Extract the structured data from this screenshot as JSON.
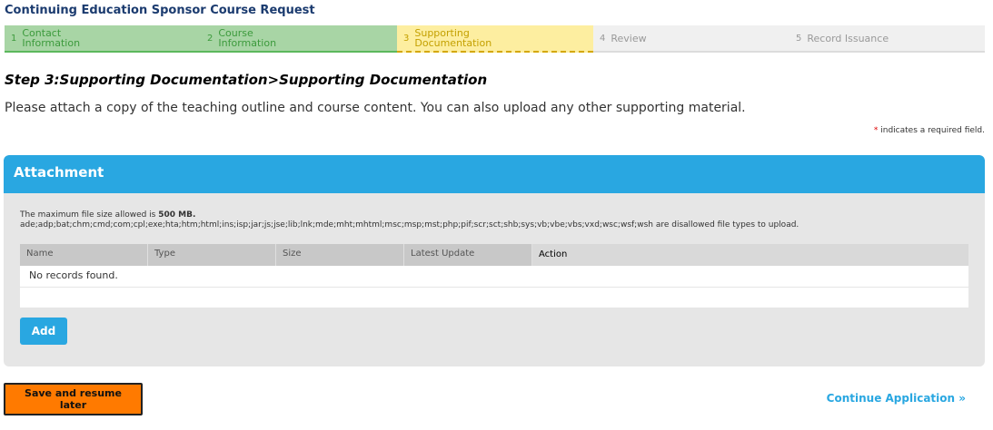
{
  "page": {
    "title": "Continuing Education Sponsor Course Request"
  },
  "steps": [
    {
      "num": "1",
      "label": "Contact Information",
      "state": "done"
    },
    {
      "num": "2",
      "label": "Course Information",
      "state": "done"
    },
    {
      "num": "3",
      "label": "Supporting Documentation",
      "state": "current"
    },
    {
      "num": "4",
      "label": "Review",
      "state": "todo"
    },
    {
      "num": "5",
      "label": "Record Issuance",
      "state": "todo"
    }
  ],
  "content": {
    "step_title": "Step 3:Supporting Documentation>Supporting Documentation",
    "instructions": "Please attach a copy of the teaching outline and course content. You can also upload any other supporting material.",
    "required_star": "*",
    "required_text": "indicates a required field."
  },
  "attachment": {
    "header": "Attachment",
    "max_size_prefix": "The maximum file size allowed is",
    "max_size_value": "500 MB.",
    "disallowed": "ade;adp;bat;chm;cmd;com;cpl;exe;hta;htm;html;ins;isp;jar;js;jse;lib;lnk;mde;mht;mhtml;msc;msp;mst;php;pif;scr;sct;shb;sys;vb;vbe;vbs;vxd;wsc;wsf;wsh are disallowed file types to upload.",
    "columns": [
      "Name",
      "Type",
      "Size",
      "Latest Update",
      "Action"
    ],
    "empty_text": "No records found.",
    "add_label": "Add"
  },
  "footer": {
    "save_label": "Save and resume later",
    "continue_label": "Continue Application »"
  },
  "colors": {
    "accent": "#29a7e1",
    "save_button": "#ff7a00",
    "step_done": "#a8d5a5",
    "step_current": "#fdeea0"
  }
}
